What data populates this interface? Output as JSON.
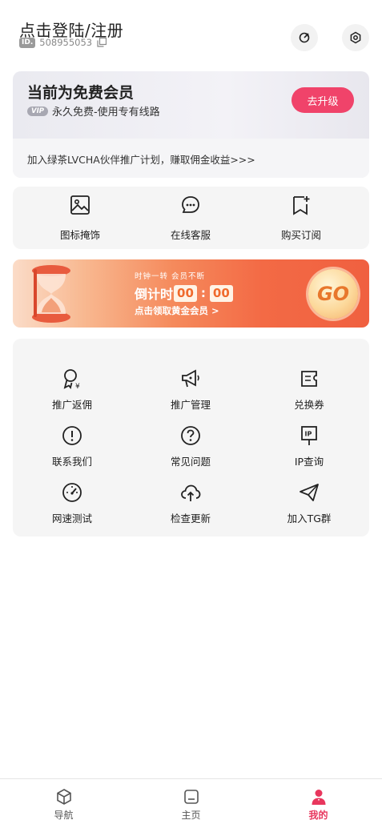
{
  "header": {
    "login_title": "点击登陆/注册",
    "id_badge": "ID.",
    "user_id": "508955053"
  },
  "member": {
    "title": "当前为免费会员",
    "vip_tag": "VIP",
    "subtitle": "永久免费-使用专有线路",
    "upgrade_label": "去升级",
    "promo_text": "加入绿茶LVCHA伙伴推广计划，赚取佣金收益>>>"
  },
  "quick_actions": [
    {
      "label": "图标掩饰",
      "icon": "image-icon"
    },
    {
      "label": "在线客服",
      "icon": "chat-bubble-icon"
    },
    {
      "label": "购买订阅",
      "icon": "bookmark-add-icon"
    }
  ],
  "banner": {
    "line1": "时钟一转 会员不断",
    "countdown_label": "倒计时",
    "minutes": "00",
    "colon": ":",
    "seconds": "00",
    "line3": "点击领取黄金会员 >",
    "go_label": "GO"
  },
  "grid": [
    {
      "label": "推广返佣",
      "icon": "commission-icon"
    },
    {
      "label": "推广管理",
      "icon": "megaphone-icon"
    },
    {
      "label": "兑换券",
      "icon": "coupon-icon"
    },
    {
      "label": "联系我们",
      "icon": "alert-circle-icon"
    },
    {
      "label": "常见问题",
      "icon": "question-circle-icon"
    },
    {
      "label": "IP查询",
      "icon": "ip-sign-icon"
    },
    {
      "label": "网速测试",
      "icon": "speedometer-icon"
    },
    {
      "label": "检查更新",
      "icon": "cloud-upload-icon"
    },
    {
      "label": "加入TG群",
      "icon": "paper-plane-icon"
    }
  ],
  "tabbar": [
    {
      "label": "导航",
      "icon": "cube-icon",
      "active": false
    },
    {
      "label": "主页",
      "icon": "home-icon",
      "active": false
    },
    {
      "label": "我的",
      "icon": "user-icon",
      "active": true
    }
  ],
  "colors": {
    "accent": "#f0436a",
    "active_tab": "#e8365d",
    "banner_orange": "#f36a45"
  }
}
